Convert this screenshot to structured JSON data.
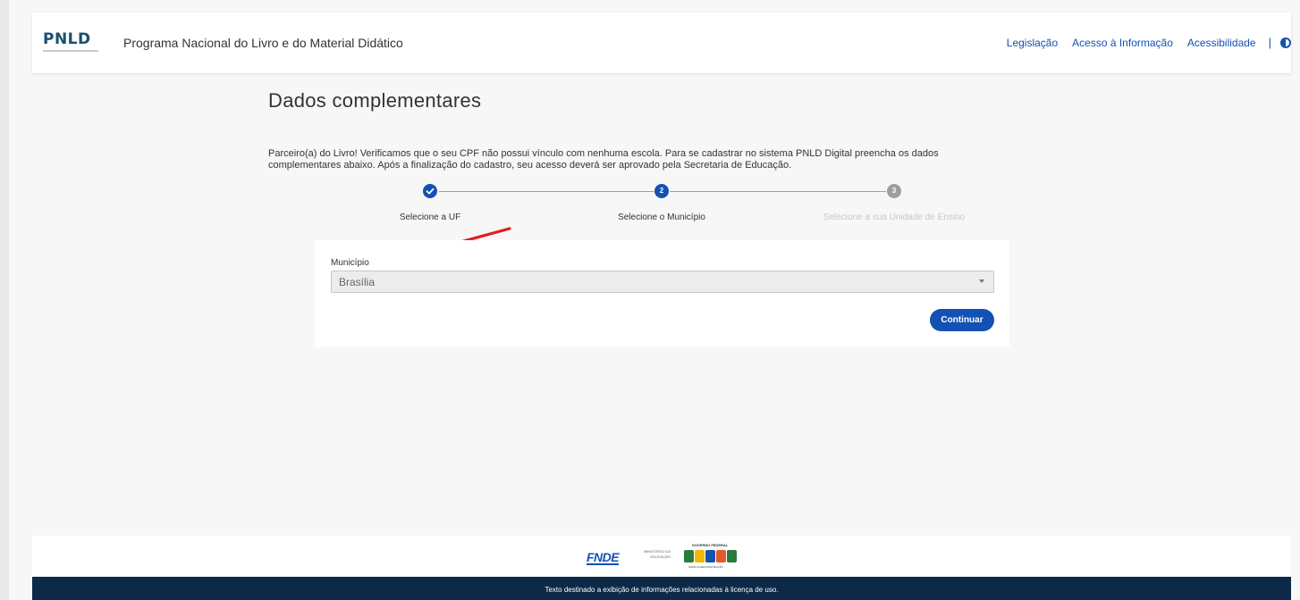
{
  "header": {
    "logo_text": "PNLD",
    "title": "Programa Nacional do Livro e do Material Didático",
    "links": [
      "Legislação",
      "Acesso à Informação",
      "Acessibilidade"
    ],
    "separator": "|"
  },
  "main": {
    "title": "Dados complementares",
    "intro": "Parceiro(a) do Livro! Verificamos que o seu CPF não possui vínculo com nenhuma escola. Para se cadastrar no sistema PNLD Digital preencha os dados complementares abaixo. Após a finalização do cadastro, seu acesso deverá ser aprovado pela Secretaria de Educação."
  },
  "stepper": {
    "steps": [
      {
        "number": "✓",
        "label": "Selecione a UF",
        "state": "done"
      },
      {
        "number": "2",
        "label": "Selecione o Município",
        "state": "current"
      },
      {
        "number": "3",
        "label": "Selecione a sua Unidade de Ensino",
        "state": "pending"
      }
    ]
  },
  "form": {
    "field_label": "Município",
    "selected_value": "Brasília",
    "submit_label": "Continuar"
  },
  "footer": {
    "fnde_label": "FNDE",
    "ministry_label": "MINISTÉRIO DA EDUCAÇÃO",
    "gov_label": "GOVERNO FEDERAL",
    "brasil_label": "BRASIL",
    "gov_slogan": "UNIÃO E RECONSTRUÇÃO",
    "license_text": "Texto destinado a exibição de informações relacionadas à licença de uso."
  },
  "colors": {
    "primary": "#1351b4",
    "footer_bg": "#0c2a47",
    "annotation_arrow": "#e21d1d"
  }
}
